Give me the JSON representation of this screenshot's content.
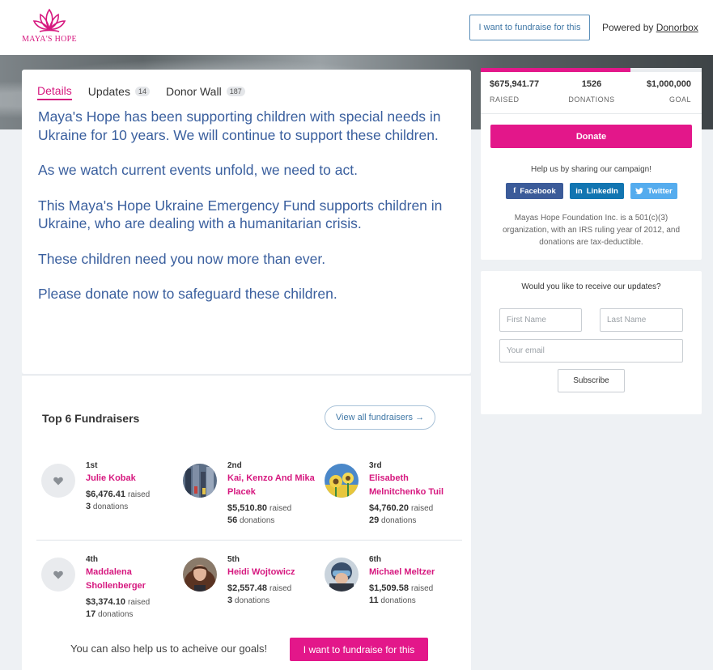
{
  "header": {
    "logo_text": "MAYA'S HOPE",
    "fundraise_btn": "I want to fundraise for this",
    "powered_by": "Powered by",
    "powered_link": "Donorbox"
  },
  "tabs": [
    {
      "label": "Details"
    },
    {
      "label": "Updates",
      "count": "14"
    },
    {
      "label": "Donor Wall",
      "count": "187"
    }
  ],
  "story": [
    "Maya's Hope has been supporting children with special needs in Ukraine for 10 years. We will continue to support these children.",
    "As we watch current events unfold, we need to act.",
    "This Maya's Hope Ukraine Emergency Fund supports children in Ukraine, who are dealing with a humanitarian crisis.",
    "These children need you now more than ever.",
    "Please donate now to safeguard these children."
  ],
  "fundraisers": {
    "title": "Top 6 Fundraisers",
    "view_all": "View all fundraisers →",
    "raised_label": "raised",
    "donations_label": "donations",
    "items": [
      {
        "rank": "1st",
        "name": "Julie Kobak",
        "amount": "$6,476.41",
        "donations": "3"
      },
      {
        "rank": "2nd",
        "name": "Kai, Kenzo And Mika Placek",
        "amount": "$5,510.80",
        "donations": "56"
      },
      {
        "rank": "3rd",
        "name": "Elisabeth Melnitchenko Tuil",
        "amount": "$4,760.20",
        "donations": "29"
      },
      {
        "rank": "4th",
        "name": "Maddalena Shollenberger",
        "amount": "$3,374.10",
        "donations": "17"
      },
      {
        "rank": "5th",
        "name": "Heidi Wojtowicz",
        "amount": "$2,557.48",
        "donations": "3"
      },
      {
        "rank": "6th",
        "name": "Michael Meltzer",
        "amount": "$1,509.58",
        "donations": "11"
      }
    ],
    "also_help": "You can also help us to acheive our goals!",
    "bottom_btn": "I want to fundraise for this"
  },
  "campaign": {
    "raised": "$675,941.77",
    "raised_label": "RAISED",
    "donations": "1526",
    "donations_label": "DONATIONS",
    "goal": "$1,000,000",
    "goal_label": "GOAL",
    "progress_fraction": 0.676,
    "donate_btn": "Donate",
    "share_text": "Help us by sharing our campaign!",
    "share": {
      "facebook": "Facebook",
      "linkedin": "LinkedIn",
      "twitter": "Twitter"
    },
    "tax_note": "Mayas Hope Foundation Inc. is a 501(c)(3) organization, with an IRS ruling year of 2012, and donations are tax-deductible."
  },
  "subscribe": {
    "question": "Would you like to receive our updates?",
    "first_name_placeholder": "First Name",
    "last_name_placeholder": "Last Name",
    "email_placeholder": "Your email",
    "button": "Subscribe"
  },
  "colors": {
    "brand_pink": "#e3178a",
    "story_blue": "#3a5f9e",
    "link_blue": "#3f77a6"
  }
}
